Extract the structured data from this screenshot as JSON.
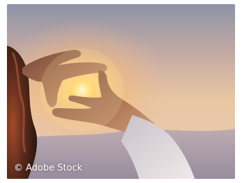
{
  "photo": {
    "subject": "hands-framing-sunset",
    "credit": "© Adobe Stock",
    "colors": {
      "sky_top": "#8d93a6",
      "sky_mid": "#e9c7a2",
      "sun_glow": "#fff1b0",
      "sun_core": "#ffb23a",
      "hills": "#9a8fa6",
      "hand": "#b07a5a",
      "hair": "#5a2a1c",
      "sleeve": "#d8d2d6"
    }
  }
}
